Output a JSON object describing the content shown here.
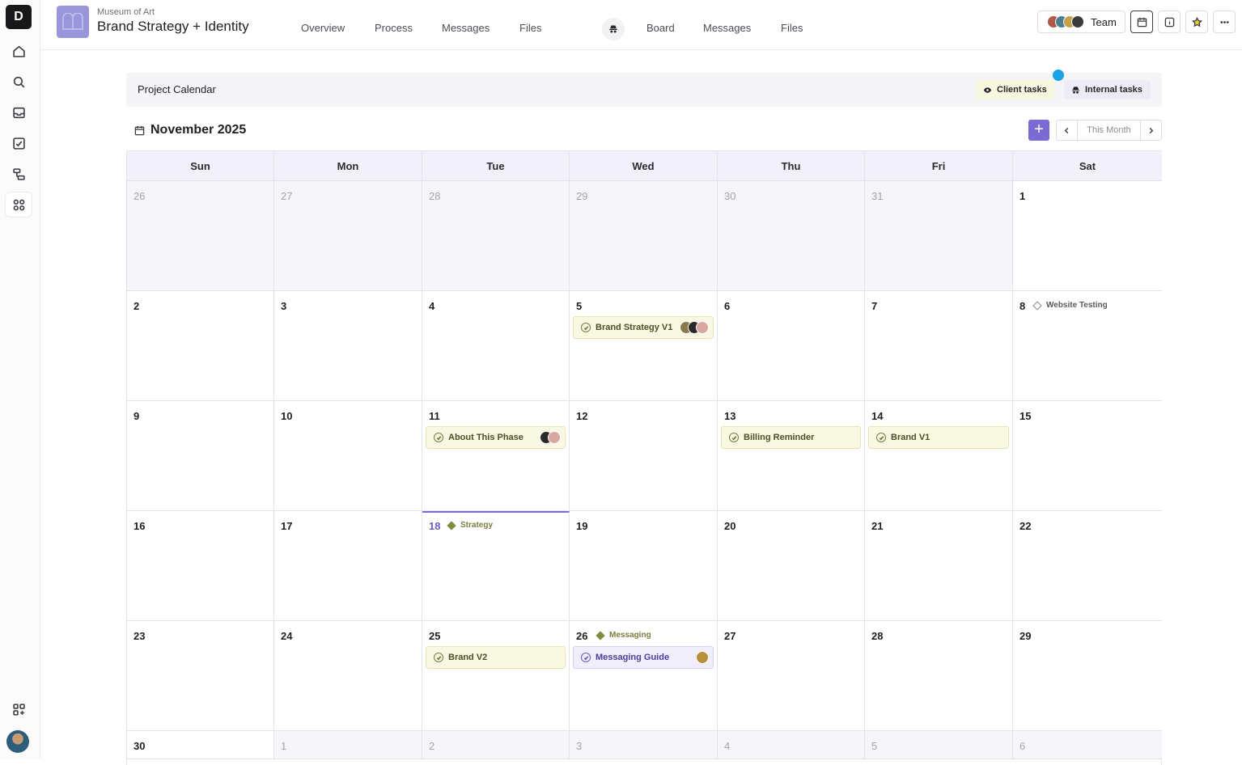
{
  "app": {
    "logo_letter": "D",
    "client_name": "Museum of Art",
    "project_title": "Brand Strategy + Identity"
  },
  "nav_client": [
    "Overview",
    "Process",
    "Messages",
    "Files"
  ],
  "nav_internal": [
    "Board",
    "Messages",
    "Files"
  ],
  "team_label": "Team",
  "calendar": {
    "section_title": "Project Calendar",
    "filters": {
      "client": "Client tasks",
      "internal": "Internal tasks"
    },
    "month_label": "November 2025",
    "add_label": "+",
    "this_month_label": "This Month",
    "weekdays": [
      "Sun",
      "Mon",
      "Tue",
      "Wed",
      "Thu",
      "Fri",
      "Sat"
    ],
    "weeks": [
      [
        "26",
        "27",
        "28",
        "29",
        "30",
        "31",
        "1"
      ],
      [
        "2",
        "3",
        "4",
        "5",
        "6",
        "7",
        "8"
      ],
      [
        "9",
        "10",
        "11",
        "12",
        "13",
        "14",
        "15"
      ],
      [
        "16",
        "17",
        "18",
        "19",
        "20",
        "21",
        "22"
      ],
      [
        "23",
        "24",
        "25",
        "26",
        "27",
        "28",
        "29"
      ],
      [
        "30",
        "1",
        "2",
        "3",
        "4",
        "5",
        "6"
      ]
    ],
    "events": {
      "brand_strategy_v1": "Brand Strategy V1",
      "website_testing": "Website Testing",
      "about_this_phase": "About This Phase",
      "billing_reminder": "Billing Reminder",
      "brand_v1": "Brand V1",
      "strategy": "Strategy",
      "brand_v2": "Brand V2",
      "messaging": "Messaging",
      "messaging_guide": "Messaging Guide"
    }
  },
  "colors": {
    "accent": "#7a6ad4",
    "client_chip": "#f9f8e2",
    "internal_chip": "#efeefa",
    "notify_dot": "#1aa3e8"
  }
}
